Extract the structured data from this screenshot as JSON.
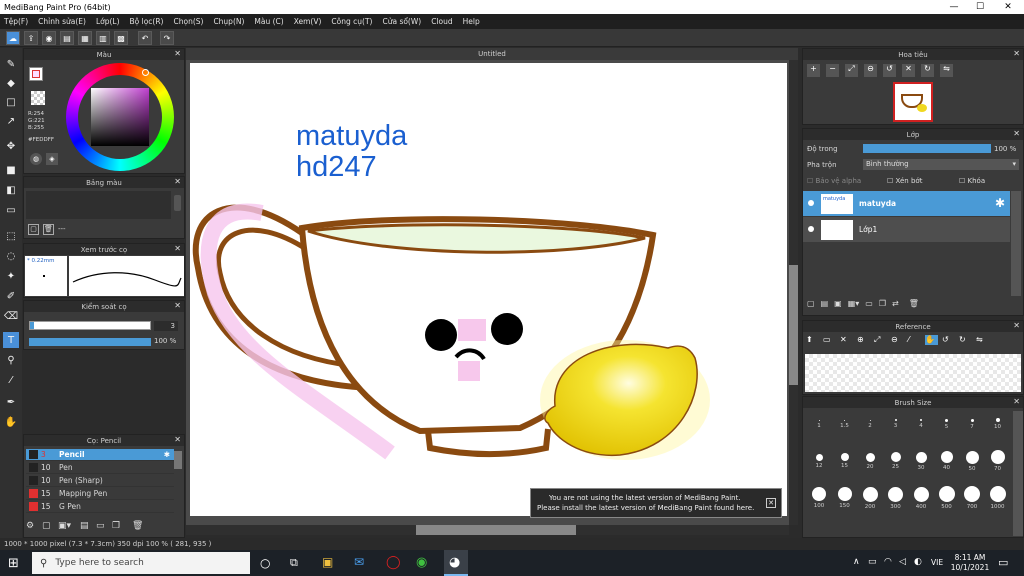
{
  "window": {
    "title": "MediBang Paint Pro (64bit)",
    "minimize": "—",
    "maximize": "☐",
    "close": "✕"
  },
  "menu": [
    "Tệp(F)",
    "Chỉnh sửa(E)",
    "Lớp(L)",
    "Bộ lọc(R)",
    "Chọn(S)",
    "Chụp(N)",
    "Màu (C)",
    "Xem(V)",
    "Công cụ(T)",
    "Cửa sổ(W)",
    "Cloud",
    "Help"
  ],
  "color_panel": {
    "title": "Màu",
    "r": "R:254",
    "g": "G:221",
    "b": "B:255",
    "hex": "#FEDDFF",
    "accent": "#FEDDFF"
  },
  "palette_panel": {
    "title": "Bảng màu",
    "dash": "---"
  },
  "preview_panel": {
    "title": "Xem trước cọ",
    "size": "* 0.22mm"
  },
  "brush_control": {
    "title": "Kiểm soát cọ",
    "size_value": "3",
    "opacity_value": "100 %"
  },
  "brush_list": {
    "title": "Cọ: Pencil",
    "items": [
      {
        "size": "3",
        "name": "Pencil",
        "color": "#222222",
        "selected": true
      },
      {
        "size": "10",
        "name": "Pen",
        "color": "#222222",
        "selected": false
      },
      {
        "size": "10",
        "name": "Pen (Sharp)",
        "color": "#222222",
        "selected": false
      },
      {
        "size": "15",
        "name": "Mapping Pen",
        "color": "#e03030",
        "selected": false
      },
      {
        "size": "15",
        "name": "G Pen",
        "color": "#e03030",
        "selected": false
      }
    ]
  },
  "canvas": {
    "tab": "Untitled",
    "text_line1": "matuyda",
    "text_line2": "hd247",
    "text_color": "#1a5fd0"
  },
  "notice": {
    "line1": "You are not using the latest version of MediBang Paint.",
    "line2": "Please install the latest version of MediBang Paint found here.",
    "close": "✕"
  },
  "navigator": {
    "title": "Hoa tiêu"
  },
  "layer_panel": {
    "title": "Lớp",
    "opacity_label": "Độ trong",
    "opacity_value": "100 %",
    "blend_label": "Pha trộn",
    "blend_value": "Bình thường",
    "protect_alpha": "Bảo vệ alpha",
    "clipping": "Xén bớt",
    "lock": "Khóa",
    "layers": [
      {
        "name": "matuyda",
        "selected": true
      },
      {
        "name": "Lớp1",
        "selected": false
      }
    ]
  },
  "reference_panel": {
    "title": "Reference"
  },
  "brush_size_panel": {
    "title": "Brush Size",
    "sizes": [
      "1",
      "1.5",
      "2",
      "3",
      "4",
      "5",
      "7",
      "10",
      "12",
      "15",
      "20",
      "25",
      "30",
      "40",
      "50",
      "70",
      "100",
      "150",
      "200",
      "300",
      "400",
      "500",
      "700",
      "1000"
    ]
  },
  "status": {
    "text": "1000 * 1000 pixel   (7.3 * 7.3cm)   350 dpi   100 %   ( 281, 935 )"
  },
  "taskbar": {
    "search_placeholder": "Type here to search",
    "lang": "VIE",
    "time": "8:11 AM",
    "date": "10/1/2021"
  }
}
